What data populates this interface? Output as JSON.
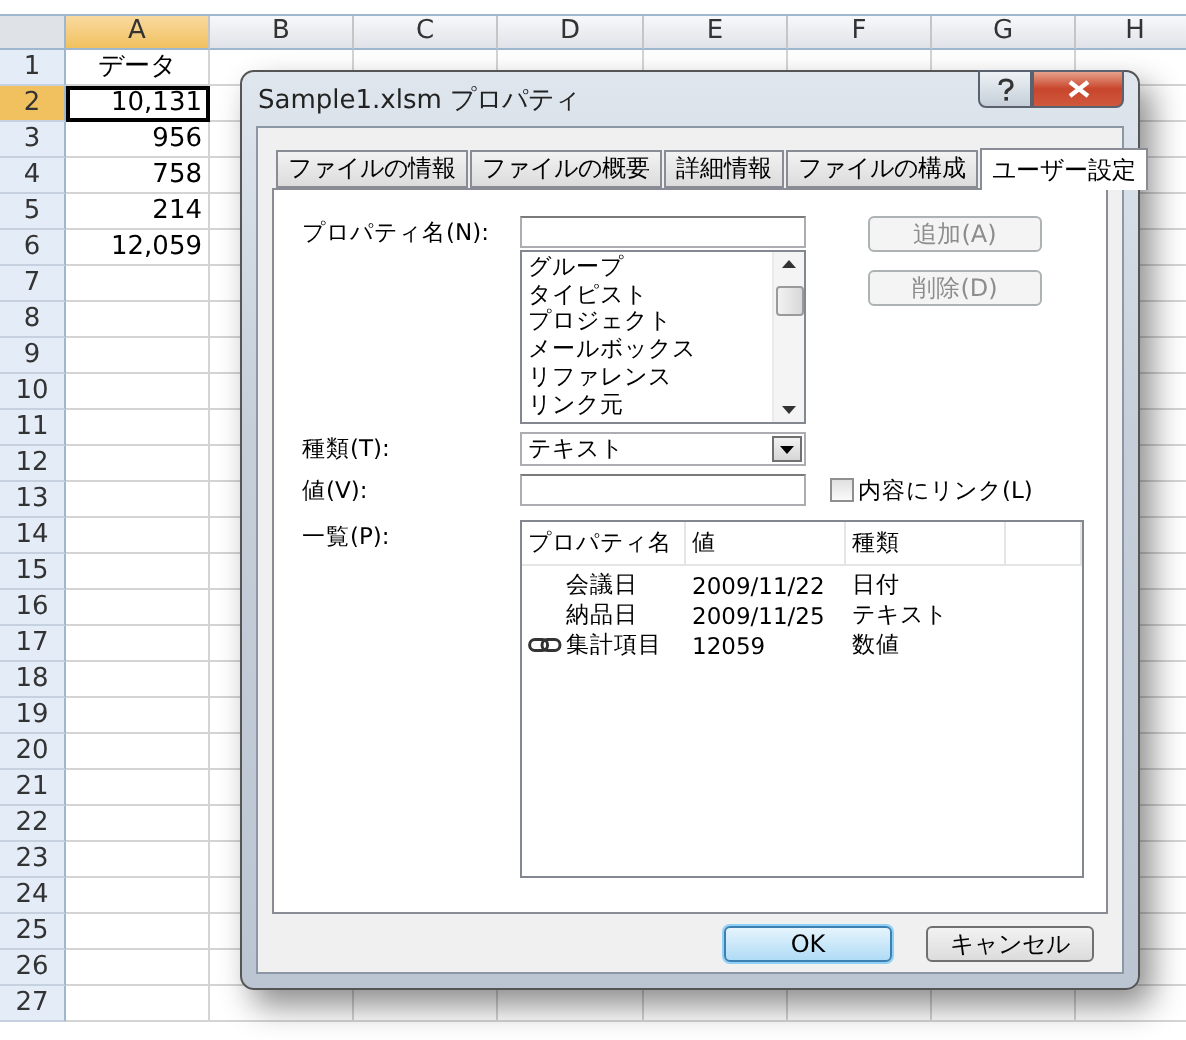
{
  "sheet": {
    "columns": [
      {
        "label": "A",
        "selected": true
      },
      {
        "label": "B",
        "selected": false
      },
      {
        "label": "C",
        "selected": false
      },
      {
        "label": "D",
        "selected": false
      },
      {
        "label": "E",
        "selected": false
      },
      {
        "label": "F",
        "selected": false
      },
      {
        "label": "G",
        "selected": false
      },
      {
        "label": "H",
        "selected": false
      }
    ],
    "rows": [
      {
        "label": "1",
        "selected": false,
        "cells": [
          {
            "value": "データ",
            "kind": "text",
            "active": false
          }
        ]
      },
      {
        "label": "2",
        "selected": true,
        "cells": [
          {
            "value": "10,131",
            "kind": "number",
            "active": true
          }
        ]
      },
      {
        "label": "3",
        "selected": false,
        "cells": [
          {
            "value": "956",
            "kind": "number",
            "active": false
          }
        ]
      },
      {
        "label": "4",
        "selected": false,
        "cells": [
          {
            "value": "758",
            "kind": "number",
            "active": false
          }
        ]
      },
      {
        "label": "5",
        "selected": false,
        "cells": [
          {
            "value": "214",
            "kind": "number",
            "active": false
          }
        ]
      },
      {
        "label": "6",
        "selected": false,
        "cells": [
          {
            "value": "12,059",
            "kind": "number",
            "active": false
          }
        ]
      },
      {
        "label": "7",
        "selected": false
      },
      {
        "label": "8",
        "selected": false
      },
      {
        "label": "9",
        "selected": false
      },
      {
        "label": "10",
        "selected": false
      },
      {
        "label": "11",
        "selected": false
      },
      {
        "label": "12",
        "selected": false
      },
      {
        "label": "13",
        "selected": false
      },
      {
        "label": "14",
        "selected": false
      },
      {
        "label": "15",
        "selected": false
      },
      {
        "label": "16",
        "selected": false
      },
      {
        "label": "17",
        "selected": false
      },
      {
        "label": "18",
        "selected": false
      },
      {
        "label": "19",
        "selected": false
      },
      {
        "label": "20",
        "selected": false
      },
      {
        "label": "21",
        "selected": false
      },
      {
        "label": "22",
        "selected": false
      },
      {
        "label": "23",
        "selected": false
      },
      {
        "label": "24",
        "selected": false
      },
      {
        "label": "25",
        "selected": false
      },
      {
        "label": "26",
        "selected": false
      },
      {
        "label": "27",
        "selected": false
      }
    ]
  },
  "dialog": {
    "title": "Sample1.xlsm プロパティ",
    "tabs": [
      {
        "label": "ファイルの情報",
        "selected": false
      },
      {
        "label": "ファイルの概要",
        "selected": false
      },
      {
        "label": "詳細情報",
        "selected": false
      },
      {
        "label": "ファイルの構成",
        "selected": false
      },
      {
        "label": "ユーザー設定",
        "selected": true
      }
    ],
    "name_label": "プロパティ名(N):",
    "name_options": [
      "グループ",
      "タイピスト",
      "プロジェクト",
      "メールボックス",
      "リファレンス",
      "リンク元"
    ],
    "side_buttons": [
      {
        "label": "追加(A)",
        "disabled": true
      },
      {
        "label": "削除(D)",
        "disabled": true
      }
    ],
    "type_label": "種類(T):",
    "type_value": "テキスト",
    "value_label": "値(V):",
    "link_checkbox": {
      "label": "内容にリンク(L)",
      "checked": false
    },
    "list_label": "一覧(P):",
    "list_columns": [
      "プロパティ名",
      "値",
      "種類"
    ],
    "properties": [
      {
        "name": "会議日",
        "value": "2009/11/22",
        "type": "日付",
        "linked": false
      },
      {
        "name": "納品日",
        "value": "2009/11/25",
        "type": "テキスト",
        "linked": false
      },
      {
        "name": "集計項目",
        "value": "12059",
        "type": "数値",
        "linked": true
      }
    ],
    "buttons": [
      {
        "label": "OK",
        "default": true
      },
      {
        "label": "キャンセル",
        "default": false
      }
    ]
  }
}
